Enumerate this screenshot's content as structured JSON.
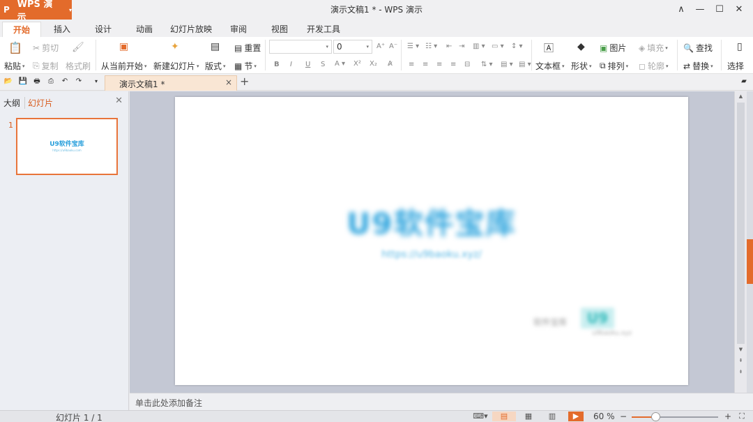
{
  "app": {
    "name": "WPS 演示",
    "logo_glyph": "P",
    "window_title": "演示文稿1 * - WPS 演示",
    "accent": "#e36b2b"
  },
  "window_controls": {
    "collapse": "∧",
    "minimize": "—",
    "maximize": "☐",
    "close": "✕"
  },
  "ribbon_tabs": [
    "开始",
    "插入",
    "设计",
    "动画",
    "幻灯片放映",
    "审阅",
    "视图",
    "开发工具"
  ],
  "active_tab": "开始",
  "toolbar": {
    "paste": "粘贴",
    "cut": "剪切",
    "copy": "复制",
    "format_painter": "格式刷",
    "from_current": "从当前开始",
    "new_slide": "新建幻灯片",
    "layout": "版式",
    "reset": "重置",
    "section": "节",
    "font_name": "",
    "font_size": "0",
    "text_box": "文本框",
    "shape": "形状",
    "picture": "图片",
    "arrange": "排列",
    "fill": "填充",
    "outline": "轮廓",
    "find": "查找",
    "replace": "替换",
    "select": "选择"
  },
  "document_tab": {
    "label": "演示文稿1 *",
    "close": "×",
    "new": "+"
  },
  "left_panel": {
    "outline_tab": "大纲",
    "slides_tab": "幻灯片",
    "close": "✕"
  },
  "thumbnail": {
    "number": "1",
    "title": "U9软件宝库",
    "url": "https://u9baoku.com"
  },
  "slide": {
    "title": "U9软件宝库",
    "url": "https://u9baoku.xyz/",
    "wm_text": "软件宝库",
    "wm_logo": "U9",
    "wm_sub": "u9baoku.xyz"
  },
  "notes": {
    "placeholder": "单击此处添加备注"
  },
  "status": {
    "slide_info": "幻灯片 1 / 1",
    "zoom": "60 %",
    "zoom_out": "−",
    "zoom_in": "+",
    "zoom_level": 0.28
  }
}
